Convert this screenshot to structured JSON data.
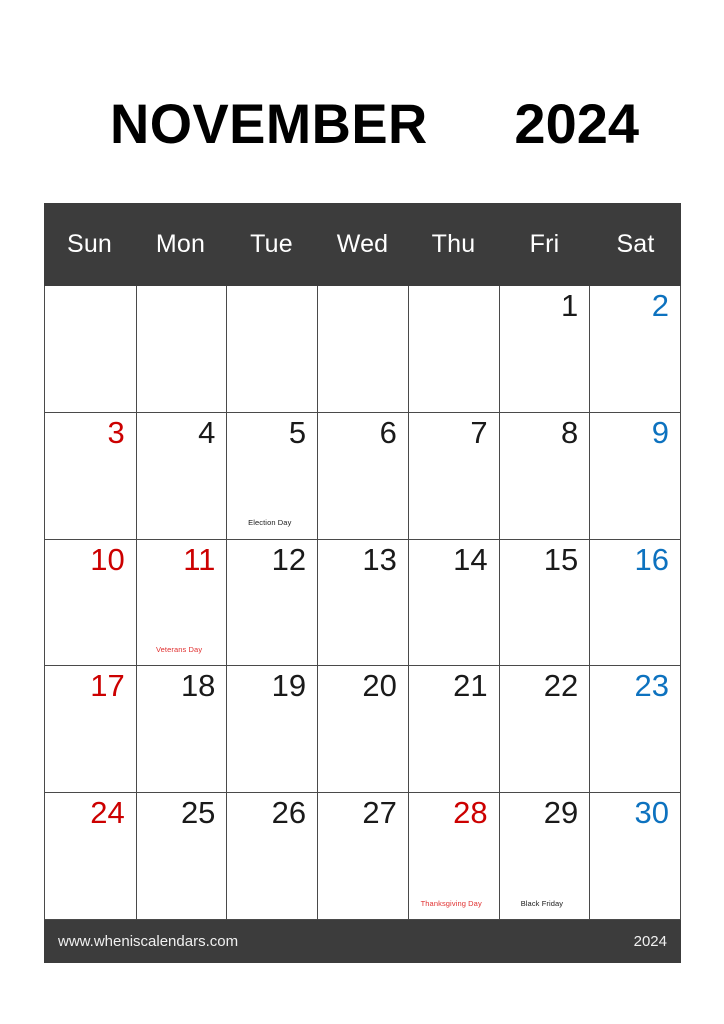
{
  "title": {
    "month": "NOVEMBER",
    "year": "2024"
  },
  "colors": {
    "header_bg": "#3c3c3c",
    "footer_bg": "#3c3c3c",
    "sunday": "#cc0000",
    "saturday": "#0d72bf",
    "weekday": "#1a1a1a",
    "holiday": "#cc0000",
    "grid_line": "#4a4a4a",
    "page_bg": "#ffffff"
  },
  "weekdays": [
    {
      "label": "Sun",
      "kind": "sun"
    },
    {
      "label": "Mon",
      "kind": "weekday"
    },
    {
      "label": "Tue",
      "kind": "weekday"
    },
    {
      "label": "Wed",
      "kind": "weekday"
    },
    {
      "label": "Thu",
      "kind": "weekday"
    },
    {
      "label": "Fri",
      "kind": "weekday"
    },
    {
      "label": "Sat",
      "kind": "sat"
    }
  ],
  "weeks": [
    [
      {
        "day": "",
        "kind": "empty",
        "event": ""
      },
      {
        "day": "",
        "kind": "empty",
        "event": ""
      },
      {
        "day": "",
        "kind": "empty",
        "event": ""
      },
      {
        "day": "",
        "kind": "empty",
        "event": ""
      },
      {
        "day": "",
        "kind": "empty",
        "event": ""
      },
      {
        "day": "1",
        "kind": "weekday",
        "event": ""
      },
      {
        "day": "2",
        "kind": "sat",
        "event": ""
      }
    ],
    [
      {
        "day": "3",
        "kind": "sun",
        "event": ""
      },
      {
        "day": "4",
        "kind": "weekday",
        "event": ""
      },
      {
        "day": "5",
        "kind": "weekday",
        "event": "Election Day",
        "event_color": "black"
      },
      {
        "day": "6",
        "kind": "weekday",
        "event": ""
      },
      {
        "day": "7",
        "kind": "weekday",
        "event": ""
      },
      {
        "day": "8",
        "kind": "weekday",
        "event": ""
      },
      {
        "day": "9",
        "kind": "sat",
        "event": ""
      }
    ],
    [
      {
        "day": "10",
        "kind": "sun",
        "event": ""
      },
      {
        "day": "11",
        "kind": "holiday",
        "event": "Veterans Day",
        "event_color": "red"
      },
      {
        "day": "12",
        "kind": "weekday",
        "event": ""
      },
      {
        "day": "13",
        "kind": "weekday",
        "event": ""
      },
      {
        "day": "14",
        "kind": "weekday",
        "event": ""
      },
      {
        "day": "15",
        "kind": "weekday",
        "event": ""
      },
      {
        "day": "16",
        "kind": "sat",
        "event": ""
      }
    ],
    [
      {
        "day": "17",
        "kind": "sun",
        "event": ""
      },
      {
        "day": "18",
        "kind": "weekday",
        "event": ""
      },
      {
        "day": "19",
        "kind": "weekday",
        "event": ""
      },
      {
        "day": "20",
        "kind": "weekday",
        "event": ""
      },
      {
        "day": "21",
        "kind": "weekday",
        "event": ""
      },
      {
        "day": "22",
        "kind": "weekday",
        "event": ""
      },
      {
        "day": "23",
        "kind": "sat",
        "event": ""
      }
    ],
    [
      {
        "day": "24",
        "kind": "sun",
        "event": ""
      },
      {
        "day": "25",
        "kind": "weekday",
        "event": ""
      },
      {
        "day": "26",
        "kind": "weekday",
        "event": ""
      },
      {
        "day": "27",
        "kind": "weekday",
        "event": ""
      },
      {
        "day": "28",
        "kind": "holiday",
        "event": "Thanksgiving Day",
        "event_color": "red"
      },
      {
        "day": "29",
        "kind": "weekday",
        "event": "Black Friday",
        "event_color": "black"
      },
      {
        "day": "30",
        "kind": "sat",
        "event": ""
      }
    ]
  ],
  "footer": {
    "url": "www.wheniscalendars.com",
    "year": "2024"
  }
}
